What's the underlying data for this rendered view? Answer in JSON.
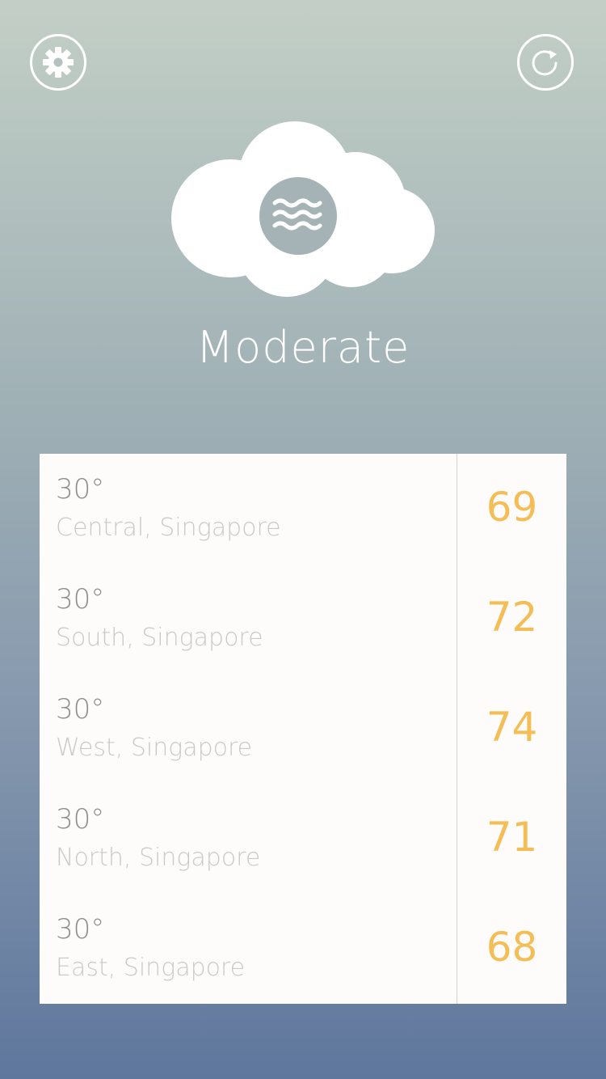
{
  "header": {
    "settings_icon": "gear-icon",
    "refresh_icon": "refresh-icon"
  },
  "status": {
    "label": "Moderate",
    "icon": "haze-cloud-icon"
  },
  "colors": {
    "accent": "#f5bd55",
    "card_bg": "#fefcfb",
    "gradient_top": "#c3cfc6",
    "gradient_bottom": "#5f779d"
  },
  "regions": [
    {
      "temp": "30°",
      "location": "Central, Singapore",
      "value": "69"
    },
    {
      "temp": "30°",
      "location": "South, Singapore",
      "value": "72"
    },
    {
      "temp": "30°",
      "location": "West, Singapore",
      "value": "74"
    },
    {
      "temp": "30°",
      "location": "North, Singapore",
      "value": "71"
    },
    {
      "temp": "30°",
      "location": "East, Singapore",
      "value": "68"
    }
  ]
}
